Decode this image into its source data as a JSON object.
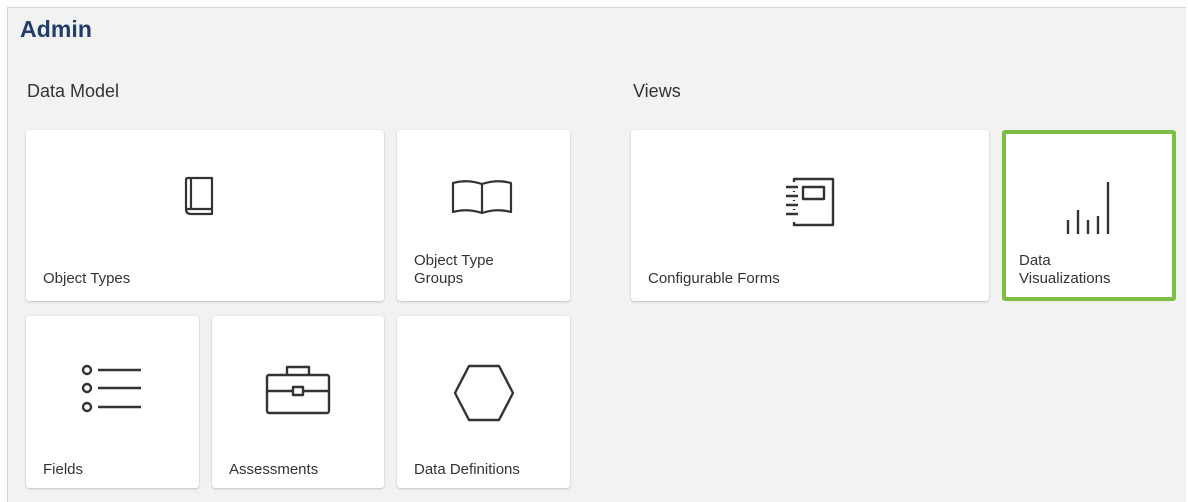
{
  "header": {
    "title": "Admin"
  },
  "sections": {
    "data_model": {
      "label": "Data Model",
      "tiles": {
        "object_types": {
          "label": "Object Types",
          "icon": "book-icon"
        },
        "object_type_groups": {
          "label": "Object Type\nGroups",
          "icon": "open-book-icon"
        },
        "fields": {
          "label": "Fields",
          "icon": "list-icon"
        },
        "assessments": {
          "label": "Assessments",
          "icon": "briefcase-icon"
        },
        "data_definitions": {
          "label": "Data Definitions",
          "icon": "hexagon-icon"
        }
      }
    },
    "views": {
      "label": "Views",
      "tiles": {
        "configurable_forms": {
          "label": "Configurable Forms",
          "icon": "notebook-icon"
        },
        "data_visualizations": {
          "label": "Data\nVisualizations",
          "icon": "bar-chart-icon",
          "selected": true
        }
      }
    }
  },
  "colors": {
    "title": "#1e3d6b",
    "selected_border": "#7cbf45",
    "icon_stroke": "#333333",
    "background": "#f2f2f2"
  }
}
